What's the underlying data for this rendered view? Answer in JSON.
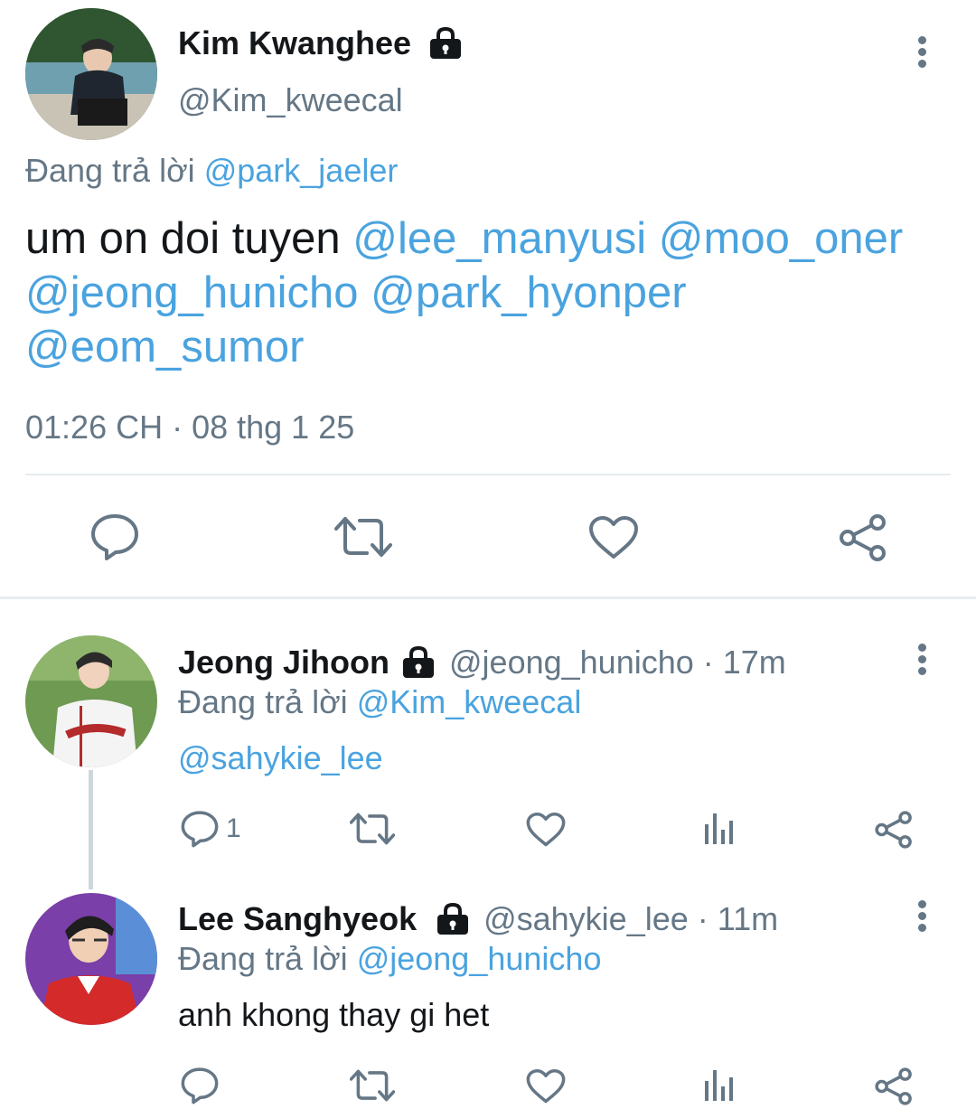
{
  "main_tweet": {
    "name": "Kim Kwanghee",
    "handle": "@Kim_kweecal",
    "replying_label": "Đang trả lời",
    "replying_to": "@park_jaeler",
    "text_plain": "um on doi tuyen ",
    "mentions": [
      "@lee_manyusi",
      "@moo_oner",
      "@jeong_hunicho",
      "@park_hyonper",
      "@eom_sumor"
    ],
    "timestamp": "01:26 CH · 08 thg 1 25"
  },
  "replies": [
    {
      "name": "Jeong Jihoon",
      "handle": "@jeong_hunicho",
      "time": "· 17m",
      "replying_label": "Đang trả lời",
      "replying_to": "@Kim_kweecal",
      "text": "@sahykie_lee",
      "reply_count": "1"
    },
    {
      "name": "Lee Sanghyeok",
      "handle": "@sahykie_lee",
      "time": "· 11m",
      "replying_label": "Đang trả lời",
      "replying_to": "@jeong_hunicho",
      "text": "anh khong thay gi het",
      "reply_count": ""
    }
  ],
  "colors": {
    "link": "#4aa3df",
    "muted": "#657786",
    "divider": "#e6ecf0"
  }
}
